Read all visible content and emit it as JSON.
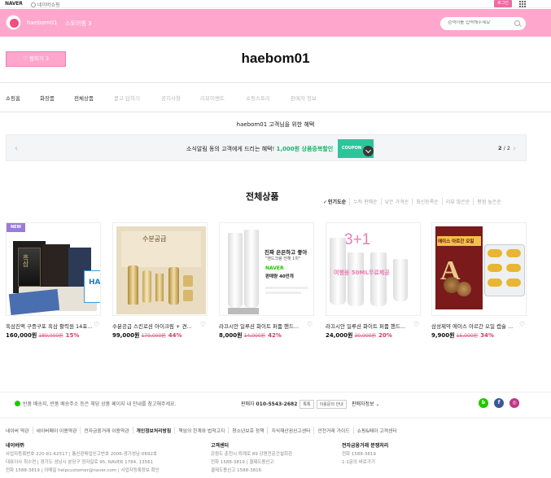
{
  "topbar": {
    "logo": "NAVER",
    "link": "네이버쇼핑",
    "login": "로그인"
  },
  "store": {
    "name": "haebom01",
    "store_link": "스토어찜 3",
    "search_placeholder": "검색어를 입력해주세요",
    "fav_button": "♡ 찜하기 3",
    "title": "haebom01"
  },
  "nav": {
    "items": [
      "쇼핑홈",
      "화장품",
      "전체상품",
      "묻고 답하기",
      "공지사항",
      "리뷰이벤트",
      "쇼핑스토리",
      "판매자 정보"
    ]
  },
  "benefit": {
    "heading": "haebom01 고객님을 위한 혜택",
    "coupon_text_pre": "소식알림 동의 고객에게 드리는 혜택! ",
    "coupon_text_hl": "1,000원 상품중복할인",
    "coupon_badge": "COUPON",
    "pager_current": "2",
    "pager_sep": " / ",
    "pager_total": "2"
  },
  "all_products": {
    "title": "전체상품",
    "sort": [
      "인기도순",
      "누적 판매순",
      "낮은 가격순",
      "최신등록순",
      "리뷰 많은순",
      "평점 높은순"
    ],
    "sort_active": "인기도순",
    "items": [
      {
        "badge": "NEW",
        "name": "흑삼진액 구증구포 흑삼 활력원 14포...",
        "price": "160,000원",
        "orig": "189,000원",
        "pct": "15%"
      },
      {
        "name": "수분공급 스킨로션 아이크림 + 견...",
        "price": "99,000원",
        "orig": "179,000원",
        "pct": "44%"
      },
      {
        "name": "라끄시안 일루션 화이트 퍼퓸 핸드...",
        "price": "8,000원",
        "orig": "14,000원",
        "pct": "42%"
      },
      {
        "name": "라끄시안 일루션 화이트 퍼퓸 핸드...",
        "price": "24,000원",
        "orig": "30,000원",
        "pct": "20%"
      },
      {
        "name": "삼성제약 에이스 아르간 오일 캡슐 ...",
        "price": "9,900원",
        "orig": "15,000원",
        "pct": "34%"
      }
    ]
  },
  "product_images": {
    "p3_line1": "진짜 은은하고 좋아",
    "p3_line2": "\"핸드크림 전해 1위\"",
    "p3_brand": "NAVER",
    "p3_rank": "판매량 40만개",
    "p4_promo": "3+1",
    "p4_sub": "여행용 50ML무료제공",
    "p5_label": "에이스 아르간 오일",
    "p2_label": "수분공급",
    "p1_label": "흑삼"
  },
  "footer": {
    "notice": "반품 배송지, 반품 배송주소 등은 해당 상품 페이지 내 안내를 참고해주세요.",
    "contact_label": "판매자 ",
    "contact_phone": "010-5543-2682",
    "contact_btn1": "톡톡",
    "contact_btn2": "이용문의 안내",
    "seller_info": "판매자정보 ⌄",
    "links": [
      "네이버 약관",
      "네이버페이 이용약관",
      "전자금융거래 이용약관",
      "개인정보처리방침",
      "책임의 한계와 법적고지",
      "청소년보호 정책",
      "지식재산권신고센터",
      "안전거래 가이드",
      "쇼핑&페이 고객센터"
    ],
    "links_strong": "개인정보처리방침",
    "col1_title": "네이버㈜",
    "col1_l1": "사업자등록번호 220-81-62517 | 통신판매업신고번호 2006-경기성남-0692호",
    "col1_l2": "대표이사 최수연 | 경기도 성남시 분당구 정자일로 95, NAVER 1784, 13561",
    "col1_l3": "전화 1588-3819 | 이메일 helpcustomer@naver.com | 사업자등록정보 확인",
    "col2_title": "고객센터",
    "col2_l1": "강원도 춘천시 퇴계로 89 강원전문건설회관",
    "col2_l2": "전화 1588-3819 | 결제도용신고",
    "col2_l3": "결제도용신고 1588-3816",
    "col3_title": "전자금융거래 분쟁처리",
    "col3_l1": "전화 1588-3819",
    "col3_l2": "1:1문의 바로가기"
  },
  "colors": {
    "pink": "#ffa6cd",
    "accent_green": "#1bb46a",
    "sale_red": "#e03a5f"
  }
}
